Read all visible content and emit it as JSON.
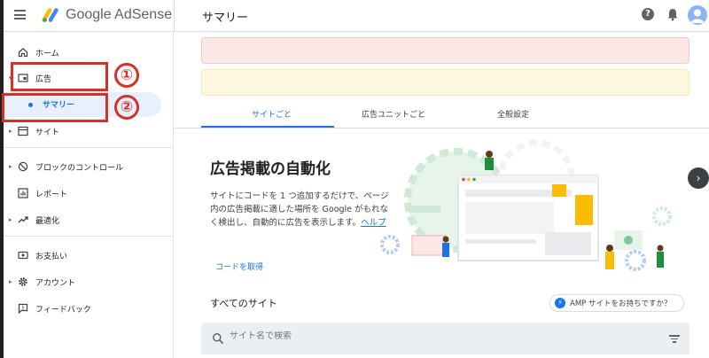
{
  "header": {
    "brand": "Google AdSense",
    "page_title": "サマリー",
    "help_glyph": "?"
  },
  "sidebar": {
    "items": [
      {
        "label": "ホーム",
        "icon": "home-icon"
      },
      {
        "label": "広告",
        "icon": "ads-icon"
      },
      {
        "label": "サマリー",
        "icon": "dot-icon"
      },
      {
        "label": "サイト",
        "icon": "sites-icon"
      },
      {
        "label": "ブロックのコントロール",
        "icon": "block-icon"
      },
      {
        "label": "レポート",
        "icon": "reports-icon"
      },
      {
        "label": "最適化",
        "icon": "trending-icon"
      },
      {
        "label": "お支払い",
        "icon": "payments-icon"
      },
      {
        "label": "アカウント",
        "icon": "gear-icon"
      },
      {
        "label": "フィードバック",
        "icon": "feedback-icon"
      }
    ]
  },
  "annotations": {
    "one": "①",
    "two": "②",
    "color": "#d93025"
  },
  "main": {
    "tabs": [
      {
        "label": "サイトごと",
        "active": true
      },
      {
        "label": "広告ユニットごと",
        "active": false
      },
      {
        "label": "全般設定",
        "active": false
      }
    ],
    "hero_title": "広告掲載の自動化",
    "hero_desc": "サイトにコードを 1 つ追加するだけで、ページ内の広告掲載に適した場所を Google がもれなく検出し、自動的に広告を表示します。",
    "help_link": "ヘルプ",
    "get_code": "コードを取得",
    "sites_title": "すべてのサイト",
    "amp_button": "AMP サイトをお持ちですか？",
    "search_placeholder": "サイト名で検索",
    "next_glyph": "›"
  },
  "colors": {
    "accent": "#1a73e8",
    "alert_red": "#fce8e6",
    "alert_yellow": "#fef7e0",
    "selected_bg": "#e8f0fe"
  }
}
